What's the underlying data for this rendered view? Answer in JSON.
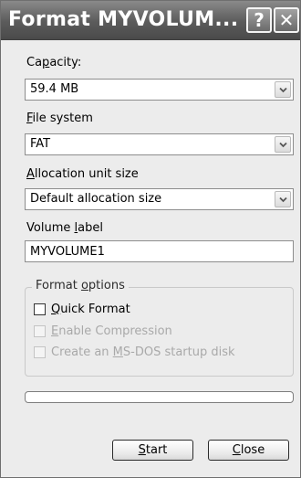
{
  "window": {
    "title": "Format MYVOLUM...",
    "help_glyph": "?",
    "close_glyph": "✕"
  },
  "capacity": {
    "label_pre": "Ca",
    "label_key": "p",
    "label_post": "acity:",
    "value": "59.4 MB"
  },
  "file_system": {
    "label_pre": "",
    "label_key": "F",
    "label_post": "ile system",
    "value": "FAT"
  },
  "allocation": {
    "label_pre": "",
    "label_key": "A",
    "label_post": "llocation unit size",
    "value": "Default allocation size"
  },
  "volume_label": {
    "label_pre": "Volume ",
    "label_key": "l",
    "label_post": "abel",
    "value": "MYVOLUME1"
  },
  "format_options": {
    "title_pre": "Format ",
    "title_key": "o",
    "title_post": "ptions",
    "options": [
      {
        "label_pre": "",
        "label_key": "Q",
        "label_post": "uick Format",
        "enabled": true,
        "checked": false
      },
      {
        "label_pre": "",
        "label_key": "E",
        "label_post": "nable Compression",
        "enabled": false,
        "checked": false
      },
      {
        "label_pre": "Create an ",
        "label_key": "M",
        "label_post": "S-DOS startup disk",
        "enabled": false,
        "checked": false
      }
    ]
  },
  "progress": {
    "fraction": 0
  },
  "buttons": {
    "start_pre": "",
    "start_key": "S",
    "start_post": "tart",
    "close_pre": "",
    "close_key": "C",
    "close_post": "lose"
  },
  "colors": {
    "titlebar": "#5b5b5b",
    "dialog_background": "#ececec",
    "disabled_text": "#a9a9a9"
  },
  "icons": {
    "dropdown": "chevron-down-icon",
    "help": "help-icon",
    "close": "close-icon"
  }
}
